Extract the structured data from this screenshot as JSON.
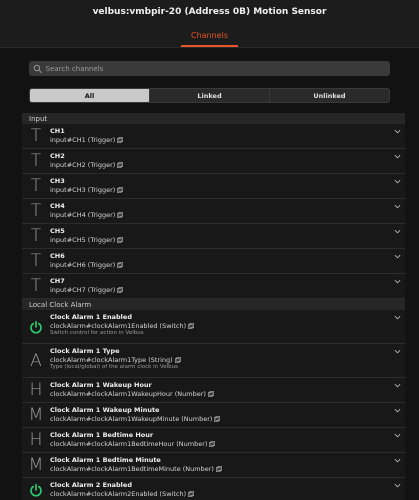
{
  "window": {
    "title": "velbus:vmbpir-20 (Address 0B) Motion Sensor"
  },
  "tabs": [
    {
      "label": "Channels"
    }
  ],
  "search": {
    "placeholder": "Search channels"
  },
  "filters": [
    {
      "label": "All"
    },
    {
      "label": "Linked"
    },
    {
      "label": "Unlinked"
    }
  ],
  "groups": [
    {
      "label": "Input",
      "items": [
        {
          "icon": "T",
          "name": "CH1",
          "uid": "input#CH1 (Trigger)"
        },
        {
          "icon": "T",
          "name": "CH2",
          "uid": "input#CH2 (Trigger)"
        },
        {
          "icon": "T",
          "name": "CH3",
          "uid": "input#CH3 (Trigger)"
        },
        {
          "icon": "T",
          "name": "CH4",
          "uid": "input#CH4 (Trigger)"
        },
        {
          "icon": "T",
          "name": "CH5",
          "uid": "input#CH5 (Trigger)"
        },
        {
          "icon": "T",
          "name": "CH6",
          "uid": "input#CH6 (Trigger)"
        },
        {
          "icon": "T",
          "name": "CH7",
          "uid": "input#CH7 (Trigger)"
        }
      ]
    },
    {
      "label": "Local Clock Alarm",
      "items": [
        {
          "icon": "power",
          "name": "Clock Alarm 1 Enabled",
          "uid": "clockAlarm#clockAlarm1Enabled (Switch)",
          "desc": "Switch control for action in Velbus"
        },
        {
          "icon": "A",
          "name": "Clock Alarm 1 Type",
          "uid": "clockAlarm#clockAlarm1Type (String)",
          "desc": "Type (local/global) of the alarm clock in Velbus"
        },
        {
          "icon": "H",
          "name": "Clock Alarm 1 Wakeup Hour",
          "uid": "clockAlarm#clockAlarm1WakeupHour (Number)"
        },
        {
          "icon": "M",
          "name": "Clock Alarm 1 Wakeup Minute",
          "uid": "clockAlarm#clockAlarm1WakeupMinute (Number)"
        },
        {
          "icon": "H",
          "name": "Clock Alarm 1 Bedtime Hour",
          "uid": "clockAlarm#clockAlarm1BedtimeHour (Number)"
        },
        {
          "icon": "M",
          "name": "Clock Alarm 1 Bedtime Minute",
          "uid": "clockAlarm#clockAlarm1BedtimeMinute (Number)"
        },
        {
          "icon": "power",
          "name": "Clock Alarm 2 Enabled",
          "uid": "clockAlarm#clockAlarm2Enabled (Switch)"
        }
      ]
    }
  ],
  "colors": {
    "accent": "#e8552a",
    "power_on": "#2ecc71"
  }
}
